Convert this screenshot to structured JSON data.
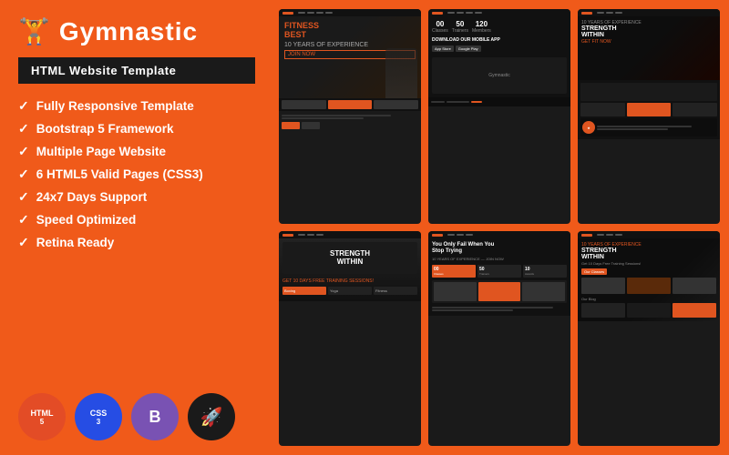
{
  "brand": {
    "logo_icon": "🏋",
    "logo_text": "Gymnastic",
    "subtitle": "HTML Website Template"
  },
  "features": [
    "Fully Responsive Template",
    "Bootstrap 5 Framework",
    "Multiple Page Website",
    "6 HTML5 Valid Pages (CSS3)",
    "24x7 Days Support",
    "Speed Optimized",
    "Retina Ready"
  ],
  "badges": [
    {
      "label": "HTML 5",
      "type": "html"
    },
    {
      "label": "CSS 3",
      "type": "css"
    },
    {
      "label": "B",
      "type": "bootstrap"
    },
    {
      "label": "🚀",
      "type": "rocket"
    }
  ],
  "previews": [
    {
      "id": "card1",
      "title": "FITNESS BEST",
      "subtitle": "10 Years of Experience"
    },
    {
      "id": "card2",
      "title": "Download Our Mobile App",
      "stats": [
        "00",
        "50",
        "120"
      ]
    },
    {
      "id": "card3",
      "title": "STRENGTH WITHIN"
    },
    {
      "id": "card4",
      "title": "STRENGTH WITHIN",
      "sub": "Get 10 Days Free Training Sessions!"
    },
    {
      "id": "card5",
      "title": "You Only Fail When You Stop Trying"
    },
    {
      "id": "card6",
      "title": "STRENGTH WITHIN"
    }
  ]
}
